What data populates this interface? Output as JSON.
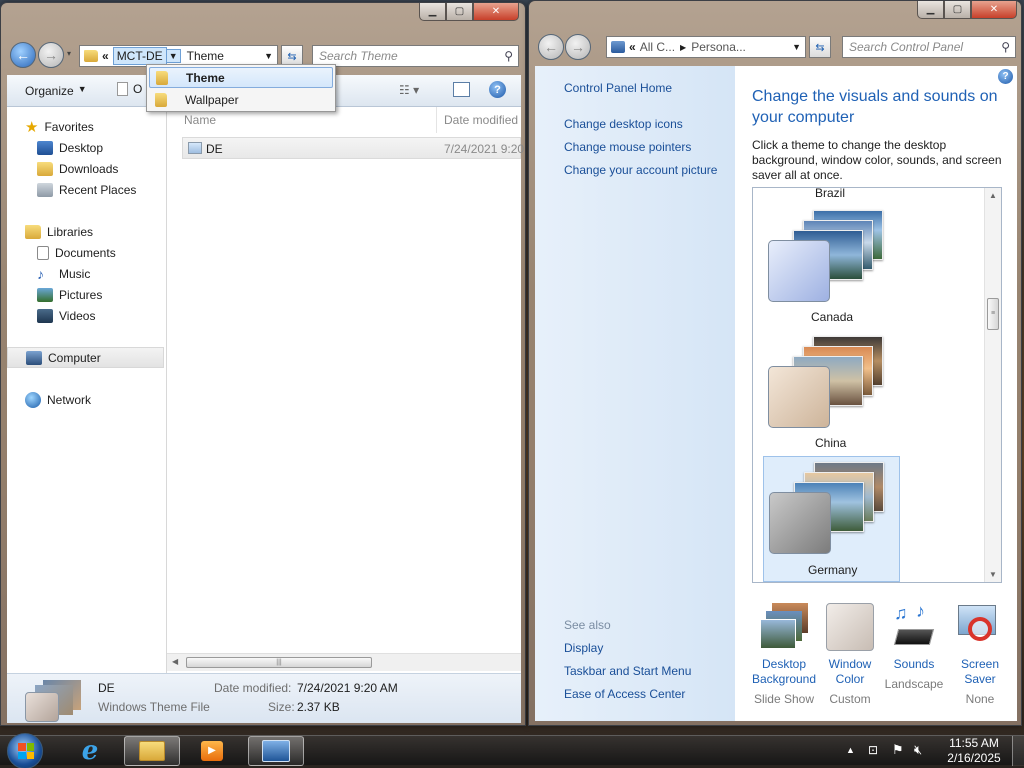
{
  "explorer": {
    "address": {
      "overflow": "«",
      "segment": "MCT-DE",
      "current": "Theme"
    },
    "search_placeholder": "Search Theme",
    "toolbar": {
      "organize": "Organize",
      "open_partial": "O"
    },
    "breadcrumb_menu": [
      "Theme",
      "Wallpaper"
    ],
    "nav": {
      "favorites": "Favorites",
      "favorites_items": [
        "Desktop",
        "Downloads",
        "Recent Places"
      ],
      "libraries": "Libraries",
      "libraries_items": [
        "Documents",
        "Music",
        "Pictures",
        "Videos"
      ],
      "computer": "Computer",
      "network": "Network"
    },
    "columns": {
      "name": "Name",
      "date": "Date modified"
    },
    "files": [
      {
        "name": "DE",
        "date": "7/24/2021 9:20"
      }
    ],
    "details": {
      "name": "DE",
      "type": "Windows Theme File",
      "date_label": "Date modified:",
      "date": "7/24/2021 9:20 AM",
      "size_label": "Size:",
      "size": "2.37 KB"
    }
  },
  "control_panel": {
    "address": {
      "overflow": "«",
      "part1": "All C...",
      "part2": "Persona..."
    },
    "search_placeholder": "Search Control Panel",
    "sidebar": {
      "home": "Control Panel Home",
      "links": [
        "Change desktop icons",
        "Change mouse pointers",
        "Change your account picture"
      ],
      "see_also": "See also",
      "see_also_links": [
        "Display",
        "Taskbar and Start Menu",
        "Ease of Access Center"
      ]
    },
    "heading": "Change the visuals and sounds on your computer",
    "description": "Click a theme to change the desktop background, window color, sounds, and screen saver all at once.",
    "themes": [
      {
        "name": "Brazil"
      },
      {
        "name": "Canada"
      },
      {
        "name": "China"
      },
      {
        "name": "Germany",
        "selected": true
      }
    ],
    "bottom": [
      {
        "label": "Desktop Background",
        "sub": "Slide Show",
        "icon": "desktop-background-icon"
      },
      {
        "label": "Window Color",
        "sub": "Custom",
        "icon": "window-color-icon"
      },
      {
        "label": "Sounds",
        "sub": "Landscape",
        "icon": "sounds-icon"
      },
      {
        "label": "Screen Saver",
        "sub": "None",
        "icon": "screen-saver-icon"
      }
    ]
  },
  "taskbar": {
    "time": "11:55 AM",
    "date": "2/16/2025"
  },
  "colors": {
    "link": "#1f61b5",
    "accent": "#2a66b8"
  }
}
